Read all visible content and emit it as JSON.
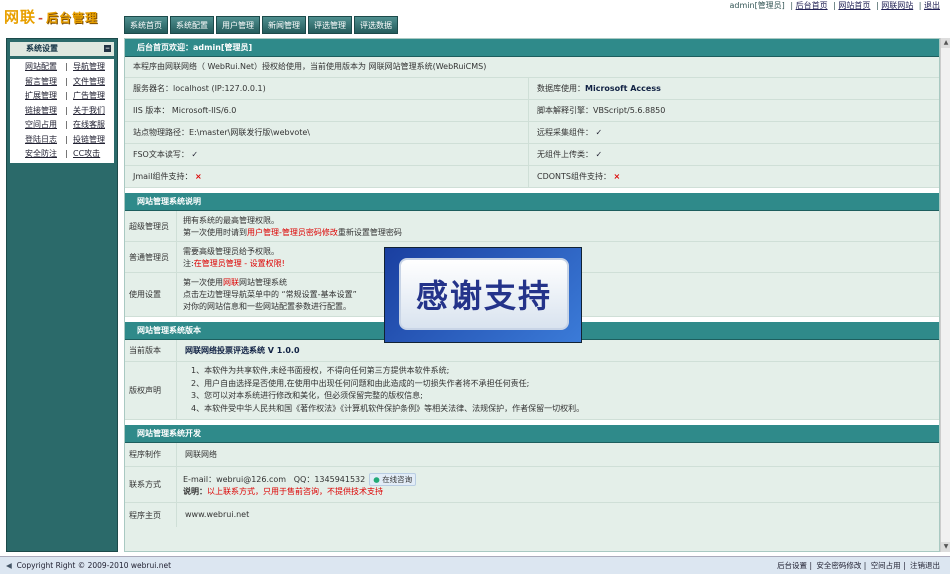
{
  "header": {
    "logo_main": "网联",
    "logo_sep": "-",
    "logo_sub": "后台管理",
    "nav_tabs": [
      "系统首页",
      "系统配置",
      "用户管理",
      "新闻管理",
      "评选管理",
      "评选数据"
    ],
    "top_user": "admin[管理员]",
    "top_links": [
      "后台首页",
      "网站首页",
      "网联网站",
      "退出"
    ],
    "top_sep": "|"
  },
  "sidebar": {
    "title": "系统设置",
    "min_icon": "minus-icon",
    "rows": [
      [
        "网站配置",
        "导航管理"
      ],
      [
        "留言管理",
        "文件管理"
      ],
      [
        "扩展管理",
        "广告管理"
      ],
      [
        "链接管理",
        "关于我们"
      ],
      [
        "空间占用",
        "在线客服"
      ],
      [
        "登陆日志",
        "投链管理"
      ],
      [
        "安全防注",
        "CC攻击"
      ]
    ],
    "sep": "|"
  },
  "welcome": {
    "title": "后台首页欢迎：admin[管理员]",
    "license": "本程序由网联网络（ WebRui.Net）授权给使用，当前使用版本为 网联网站管理系统(WebRuiCMS)",
    "server_name": "服务器名：localhost (IP:127.0.0.1)",
    "db_label": "数据库使用：",
    "db_value": "Microsoft Access",
    "iis": "IIS 版本： Microsoft-IIS/6.0",
    "script_engine": "脚本解释引擎：VBScript/5.6.8850",
    "path": "站点物理路径：E:\\master\\网联发行版\\webvote\\",
    "remote_collect": "远程采集组件：",
    "fso": "FSO文本读写：",
    "no_upload": "无组件上传类：",
    "jmail": "Jmail组件支持：",
    "cdonts": "CDONTS组件支持：",
    "check": "✓",
    "cross": "×"
  },
  "instructions": {
    "title": "网站管理系统说明",
    "super_label": "超级管理员",
    "super_line1": "拥有系统的最高管理权限。",
    "super_line2_pre": "第一次使用时请到",
    "super_line2_red": "用户管理-管理员密码修改",
    "super_line2_post": "重新设置管理密码",
    "normal_label": "普通管理员",
    "normal_line1": "需要高级管理员给予权限。",
    "normal_line2_pre": "注:",
    "normal_line2_red": "在管理员管理 - 设置权限!",
    "use_label": "使用设置",
    "use_line1_pre": "第一次使用",
    "use_line1_red": "网联",
    "use_line1_post": "网站管理系统",
    "use_line2": "点击左边管理导航菜单中的 “常规设置-基本设置”",
    "use_line3": "对你的网站信息和一些网站配置参数进行配置。"
  },
  "version": {
    "title": "网站管理系统版本",
    "current_label": "当前版本",
    "current_value": "网联网络投票评选系统 V 1.0.0",
    "copyright_label": "版权声明",
    "copyright_items": [
      "1、本软件为共享软件,未经书面授权，不得向任何第三方提供本软件系统;",
      "2、用户自由选择是否使用,在使用中出现任何问题和由此造成的一切损失作者将不承担任何责任;",
      "3、您可以对本系统进行修改和美化，但必须保留完整的版权信息;",
      "4、本软件受中华人民共和国《著作权法》《计算机软件保护条例》等相关法律、法规保护，作者保留一切权利。"
    ]
  },
  "development": {
    "title": "网站管理系统开发",
    "maker_label": "程序制作",
    "maker_value": "网联网络",
    "contact_label": "联系方式",
    "email": "E-mail：webrui@126.com",
    "qq": "QQ：1345941532",
    "consult_label": "在线咨询",
    "note_label": "说明：",
    "note_value": "以上联系方式，只用于售前咨询，不提供技术支持",
    "home_label": "程序主页",
    "home_value": "www.webrui.net"
  },
  "popup": {
    "text": "感谢支持"
  },
  "footer": {
    "copyright": "Copyright Right © 2009-2010",
    "site": "webrui.net",
    "links": [
      "后台设置",
      "安全密码修改",
      "空间占用",
      "注销退出"
    ],
    "sep": "|"
  }
}
